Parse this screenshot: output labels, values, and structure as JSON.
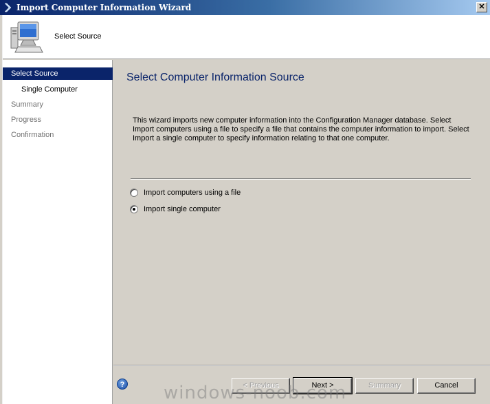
{
  "window": {
    "title": "Import Computer Information Wizard",
    "close_glyph": "✕"
  },
  "header": {
    "title": "Select Source",
    "icon": "computer-monitor-icon"
  },
  "sidebar": {
    "items": [
      {
        "label": "Select Source",
        "state": "selected"
      },
      {
        "label": "Single Computer",
        "state": "sub"
      },
      {
        "label": "Summary",
        "state": "disabled"
      },
      {
        "label": "Progress",
        "state": "disabled"
      },
      {
        "label": "Confirmation",
        "state": "disabled"
      }
    ]
  },
  "main": {
    "heading": "Select Computer Information Source",
    "description": "This wizard imports new computer information into the Configuration Manager database. Select Import computers using a file to specify a file that contains the computer information to import. Select Import a single computer to specify information relating to that one computer.",
    "options": [
      {
        "label": "Import computers using a file",
        "checked": false
      },
      {
        "label": "Import single computer",
        "checked": true
      }
    ]
  },
  "footer": {
    "help_glyph": "?",
    "previous_label": "< Previous",
    "next_label": "Next >",
    "summary_label": "Summary",
    "cancel_label": "Cancel"
  },
  "watermark": "windows-noob.com",
  "colors": {
    "title_start": "#0a246a",
    "title_end": "#a6caf0",
    "selected_bg": "#0a246a",
    "heading": "#0a246a"
  }
}
